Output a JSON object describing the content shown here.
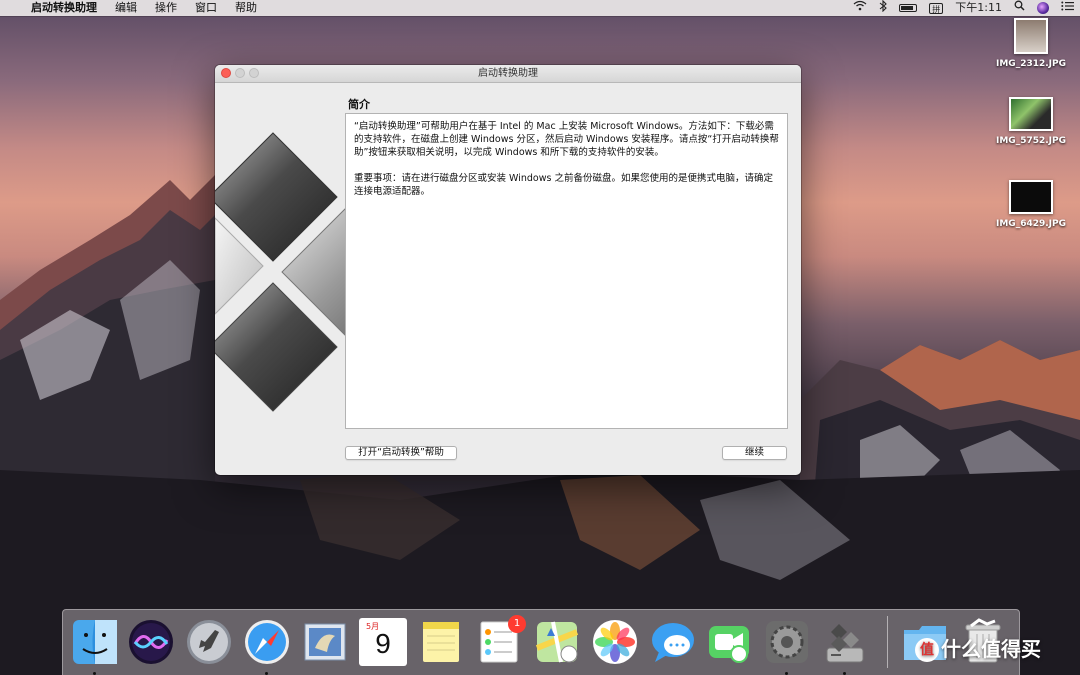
{
  "menubar": {
    "apple_glyph": "",
    "items": [
      "启动转换助理",
      "编辑",
      "操作",
      "窗口",
      "帮助"
    ],
    "input_method": "拼",
    "clock": "下午1:11"
  },
  "desktop_files": [
    {
      "name": "IMG_2312.JPG"
    },
    {
      "name": "IMG_5752.JPG"
    },
    {
      "name": "IMG_6429.JPG"
    }
  ],
  "window": {
    "title": "启动转换助理",
    "section_title": "简介",
    "paragraphs": [
      "“启动转换助理”可帮助用户在基于 Intel 的 Mac 上安装 Microsoft Windows。方法如下：下载必需的支持软件，在磁盘上创建 Windows 分区，然后启动 Windows 安装程序。请点按“打开启动转换帮助”按钮来获取相关说明，以完成 Windows 和所下载的支持软件的安装。",
      "重要事项：请在进行磁盘分区或安装 Windows 之前备份磁盘。如果您使用的是便携式电脑，请确定连接电源适配器。"
    ],
    "help_button": "打开“启动转换”帮助",
    "continue_button": "继续"
  },
  "dock": {
    "calendar_month": "5月",
    "calendar_day": "9",
    "reminders_badge": "1",
    "apps": [
      "finder-icon",
      "siri-icon",
      "launchpad-icon",
      "safari-icon",
      "mail-icon",
      "calendar-icon",
      "notes-icon",
      "reminders-icon",
      "maps-icon",
      "photos-icon",
      "messages-icon",
      "facetime-icon",
      "system-preferences-icon",
      "bootcamp-icon",
      "downloads-folder-icon",
      "trash-icon"
    ]
  },
  "watermark": {
    "circle_char": "值",
    "text": "什么值得买"
  }
}
